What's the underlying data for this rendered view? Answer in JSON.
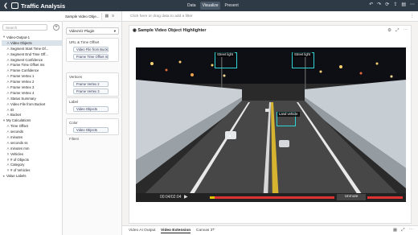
{
  "app": {
    "title": "Traffic Analysis"
  },
  "nav": {
    "tabs": [
      {
        "label": "Data"
      },
      {
        "label": "Visualize"
      },
      {
        "label": "Present"
      }
    ]
  },
  "left_panel": {
    "search_placeholder": "Search",
    "tree": [
      {
        "label": "Video-Output-1",
        "icon": "▾",
        "type": "folder"
      },
      {
        "label": "Video Objects",
        "icon": "A",
        "type": "field",
        "selected": true
      },
      {
        "label": "Segment Start Time Of...",
        "icon": "A",
        "type": "field"
      },
      {
        "label": "Segment End Time Off...",
        "icon": "A",
        "type": "field"
      },
      {
        "label": "Segment Confidence",
        "icon": "A",
        "type": "field"
      },
      {
        "label": "Frame Time Offset ms",
        "icon": "A",
        "type": "field"
      },
      {
        "label": "Frame Confidence",
        "icon": "A",
        "type": "field"
      },
      {
        "label": "Frame Vertex 1",
        "icon": "A",
        "type": "field"
      },
      {
        "label": "Frame Vertex 2",
        "icon": "A",
        "type": "field"
      },
      {
        "label": "Frame Vertex 3",
        "icon": "A",
        "type": "field"
      },
      {
        "label": "Frame Vertex 4",
        "icon": "A",
        "type": "field"
      },
      {
        "label": "Status Summary",
        "icon": "A",
        "type": "field"
      },
      {
        "label": "Video File from Bucket",
        "icon": "A",
        "type": "field"
      },
      {
        "label": "ID",
        "icon": "A",
        "type": "field"
      },
      {
        "label": "Bucket",
        "icon": "A",
        "type": "field"
      },
      {
        "label": "My Calculations",
        "icon": "▾",
        "type": "folder"
      },
      {
        "label": "Time Offset",
        "icon": "A",
        "type": "field"
      },
      {
        "label": "seconds",
        "icon": "A",
        "type": "field"
      },
      {
        "label": "minutes",
        "icon": "A",
        "type": "field"
      },
      {
        "label": "seconds ss",
        "icon": "A",
        "type": "field"
      },
      {
        "label": "minutes mm",
        "icon": "A",
        "type": "field"
      },
      {
        "label": "Vehicles",
        "icon": "#",
        "type": "measure"
      },
      {
        "label": "# of Objects",
        "icon": "#",
        "type": "measure"
      },
      {
        "label": "Category",
        "icon": "A",
        "type": "field"
      },
      {
        "label": "# of Vehicles",
        "icon": "#",
        "type": "measure"
      },
      {
        "label": "Value Labels",
        "icon": "▸",
        "type": "folder"
      }
    ]
  },
  "mid_panel": {
    "tab_label": "Sample Video Obje...",
    "plugin_label": "VideoViz Plugin",
    "sections": [
      {
        "title": "URL & Time Offset",
        "chips": [
          "Video File from Bucket",
          "Frame Time Offset ms"
        ]
      },
      {
        "title": "Vertices",
        "chips": [
          "Frame Vertex 2",
          "Frame Vertex 3"
        ]
      },
      {
        "title": "Label",
        "chips": [
          "Video Objects"
        ]
      },
      {
        "title": "Color",
        "chips": [
          "Video Objects"
        ]
      }
    ],
    "filters_label": "Filters"
  },
  "canvas": {
    "filter_placeholder": "Click here or drag data to add a filter"
  },
  "viz": {
    "title": "Sample Video Object Highlighter",
    "time": "00:04/02:04",
    "unmute_label": "Unmute",
    "progress_fraction": 0.04,
    "detections": [
      {
        "label": "Street light"
      },
      {
        "label": "Street light"
      },
      {
        "label": "Land vehicle"
      }
    ]
  },
  "bottom": {
    "tabs": [
      {
        "label": "Video AI Output"
      },
      {
        "label": "Video Extension"
      },
      {
        "label": "Canvas 3"
      }
    ]
  }
}
